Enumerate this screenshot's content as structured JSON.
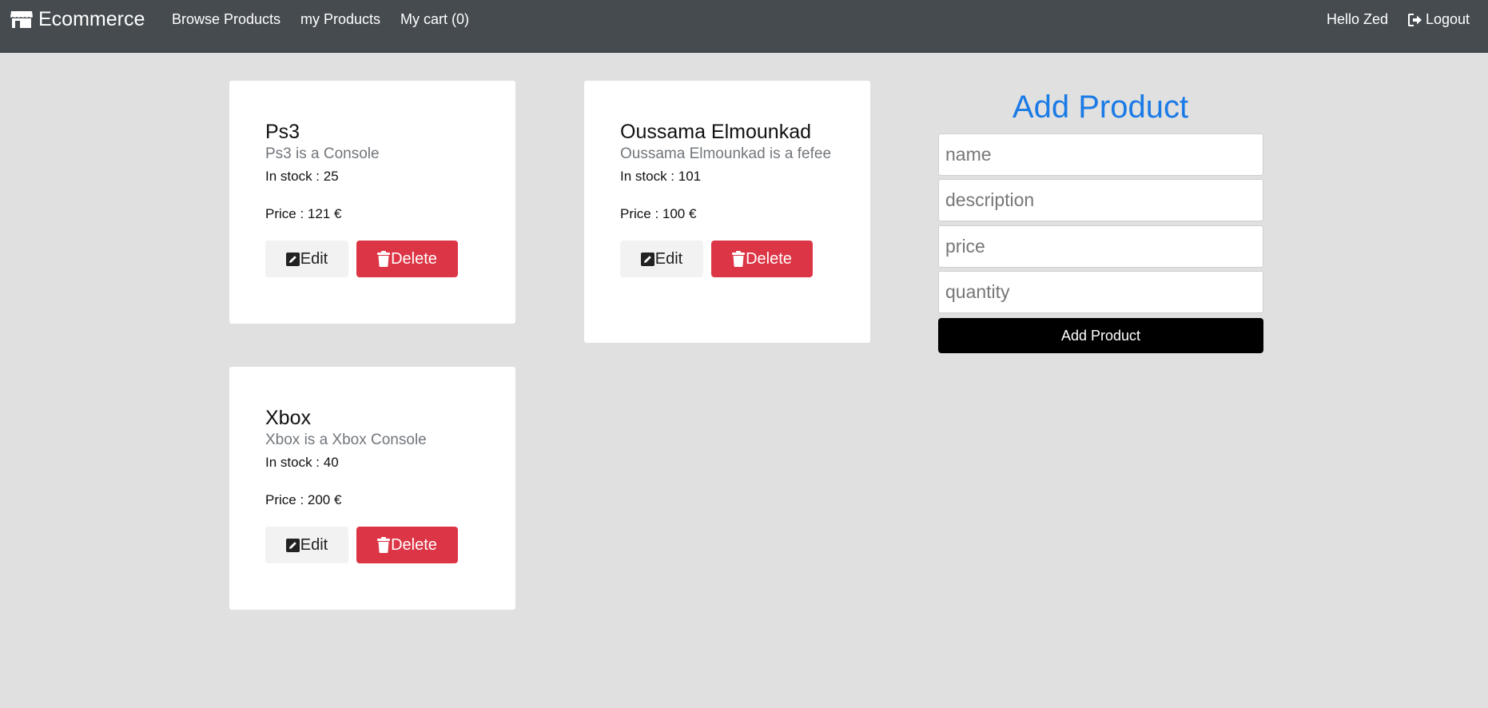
{
  "navbar": {
    "brand": "Ecommerce",
    "brand_icon": "store-icon",
    "links": [
      "Browse Products",
      "my Products",
      "My cart (0)"
    ],
    "greeting": "Hello Zed",
    "logout": "Logout",
    "logout_icon": "sign-out-icon",
    "background": "#464b50"
  },
  "products": [
    {
      "name": "Ps3",
      "description": "Ps3 is a Console",
      "stock": "In stock : 25",
      "price": "Price : 121 €",
      "edit_label": "Edit",
      "delete_label": "Delete"
    },
    {
      "name": "Oussama Elmounkad",
      "description": "Oussama Elmounkad is a fefee",
      "stock": "In stock : 101",
      "price": "Price : 100 €",
      "edit_label": "Edit",
      "delete_label": "Delete"
    },
    {
      "name": "Xbox",
      "description": "Xbox is a Xbox Console",
      "stock": "In stock : 40",
      "price": "Price : 200 €",
      "edit_label": "Edit",
      "delete_label": "Delete"
    }
  ],
  "add_form": {
    "title": "Add Product",
    "name_placeholder": "name",
    "description_placeholder": "description",
    "price_placeholder": "price",
    "quantity_placeholder": "quantity",
    "submit_label": "Add Product"
  },
  "colors": {
    "page_background": "#e0e0e0",
    "accent": "#1a7ae6",
    "delete": "#dc3545",
    "submit": "#000000"
  }
}
